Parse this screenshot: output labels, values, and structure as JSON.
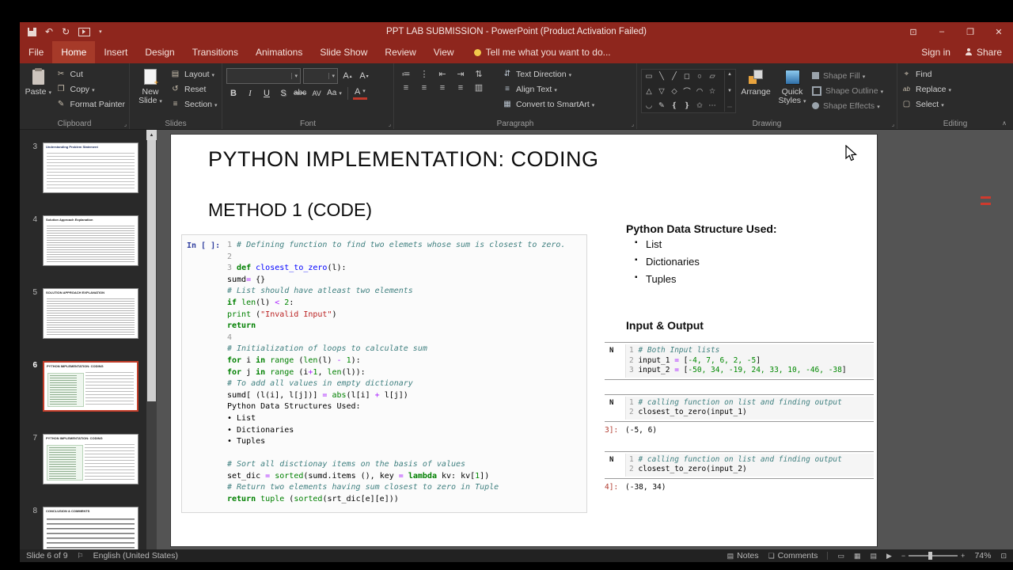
{
  "titlebar": {
    "title": "PPT LAB SUBMISSION - PowerPoint (Product Activation Failed)"
  },
  "menubar": {
    "tabs": [
      {
        "label": "File",
        "cls": "t-file"
      },
      {
        "label": "Home",
        "cls": "t-active"
      },
      {
        "label": "Insert",
        "cls": ""
      },
      {
        "label": "Design",
        "cls": ""
      },
      {
        "label": "Transitions",
        "cls": ""
      },
      {
        "label": "Animations",
        "cls": ""
      },
      {
        "label": "Slide Show",
        "cls": ""
      },
      {
        "label": "Review",
        "cls": ""
      },
      {
        "label": "View",
        "cls": ""
      }
    ],
    "tell_me": "Tell me what you want to do...",
    "sign_in": "Sign in",
    "share": "Share"
  },
  "ribbon": {
    "clipboard": {
      "label": "Clipboard",
      "paste": "Paste",
      "cut": "Cut",
      "copy": "Copy",
      "format_painter": "Format Painter"
    },
    "slides": {
      "label": "Slides",
      "new_slide": "New Slide",
      "layout": "Layout",
      "reset": "Reset",
      "section": "Section"
    },
    "font": {
      "label": "Font",
      "b": "B",
      "i": "I",
      "u": "U",
      "s": "S",
      "strike": "abc",
      "av": "AV",
      "aa": "Aa",
      "color": "A",
      "grow": "A",
      "shrink": "A"
    },
    "paragraph": {
      "label": "Paragraph",
      "text_direction": "Text Direction",
      "align_text": "Align Text",
      "smartart": "Convert to SmartArt"
    },
    "drawing": {
      "label": "Drawing",
      "arrange": "Arrange",
      "quick_styles": "Quick Styles",
      "shape_fill": "Shape Fill",
      "shape_outline": "Shape Outline",
      "shape_effects": "Shape Effects"
    },
    "editing": {
      "label": "Editing",
      "find": "Find",
      "replace": "Replace",
      "select": "Select"
    }
  },
  "icons": {
    "undo": "↶",
    "redo": "↻",
    "ribbon_display": "⊡",
    "minimize": "–",
    "restore": "❐",
    "close": "✕",
    "cut": "✂",
    "copy": "❐",
    "format_painter": "✎",
    "layout_ic": "▤",
    "reset_ic": "↺",
    "section_ic": "≡",
    "td": "⇵",
    "at": "≡",
    "sa": "▦",
    "para_row1": [
      "≔",
      "⋮",
      "⇤",
      "⇥",
      "⇅"
    ],
    "para_row2": [
      "≡",
      "≡",
      "≡",
      "≡",
      "▥"
    ],
    "shapes_r1": [
      "▭",
      "╲",
      "╱",
      "◻",
      "○",
      "▱"
    ],
    "shapes_r2": [
      "△",
      "▽",
      "◇",
      "⌒",
      "◠",
      "☆"
    ],
    "shapes_r3": [
      "◡",
      "✎",
      "❴",
      "❵",
      "✩",
      "⋯"
    ],
    "scroll_up": "▲",
    "scroll_dn": "▼",
    "more": "⋯",
    "find": "⌖",
    "replace_ab": "ab",
    "select": "▢",
    "flag": "⚐",
    "notes": "▤",
    "comments": "❏",
    "view_normal": "▭",
    "view_sorter": "▦",
    "view_reading": "▤",
    "view_show": "▶",
    "zoom_out": "−",
    "zoom_in": "+",
    "fit": "⊡",
    "collapse": "∧"
  },
  "sidebar": {
    "thumbnails": [
      {
        "num": "3",
        "cls": "kind-doc",
        "title": "Understanding Problem Statement"
      },
      {
        "num": "4",
        "cls": "kind-doc2",
        "title": "Solution Approach Explanation"
      },
      {
        "num": "5",
        "cls": "kind-doc2",
        "title": "SOLUTION APPROACH EXPLANATION"
      },
      {
        "num": "6",
        "cls": "kind-code sel",
        "title": "PYTHON IMPLEMENTATION: CODING"
      },
      {
        "num": "7",
        "cls": "kind-code",
        "title": "PYTHON IMPLEMENTATION: CODING"
      },
      {
        "num": "8",
        "cls": "kind-bullets",
        "title": "CONCLUSION & COMMENTS"
      }
    ]
  },
  "slide": {
    "title": "PYTHON IMPLEMENTATION: CODING",
    "subtitle": "METHOD 1 (CODE)",
    "in_prompt": "In [ ]:",
    "code_lines": [
      [
        [
          "ln",
          "1 "
        ],
        [
          "com",
          "# Defining function to find two elemets whose sum is closest to zero."
        ]
      ],
      [
        [
          "ln",
          "2"
        ]
      ],
      [
        [
          "ln",
          "3 "
        ],
        [
          "kw",
          "def"
        ],
        [
          "pl",
          " "
        ],
        [
          "fn",
          "closest_to_zero"
        ],
        [
          "pl",
          "(l):"
        ]
      ],
      [
        [
          "pl",
          "sumd"
        ],
        [
          "op",
          "="
        ],
        [
          "pl",
          " {}"
        ]
      ],
      [
        [
          "com",
          "# List should have atleast two elements"
        ]
      ],
      [
        [
          "kw",
          "if"
        ],
        [
          "pl",
          " "
        ],
        [
          "bi",
          "len"
        ],
        [
          "pl",
          "(l) "
        ],
        [
          "op",
          "<"
        ],
        [
          "pl",
          " "
        ],
        [
          "nm",
          "2"
        ],
        [
          "pl",
          ":"
        ]
      ],
      [
        [
          "bi",
          "print"
        ],
        [
          "pl",
          " ("
        ],
        [
          "st",
          "\"Invalid Input\""
        ],
        [
          "pl",
          ")"
        ]
      ],
      [
        [
          "kw",
          "return"
        ]
      ],
      [
        [
          "ln",
          "4"
        ]
      ],
      [
        [
          "com",
          "# Initialization of loops to calculate sum"
        ]
      ],
      [
        [
          "kw",
          "for"
        ],
        [
          "pl",
          " i "
        ],
        [
          "kw",
          "in"
        ],
        [
          "pl",
          " "
        ],
        [
          "bi",
          "range"
        ],
        [
          "pl",
          " ("
        ],
        [
          "bi",
          "len"
        ],
        [
          "pl",
          "(l) "
        ],
        [
          "op",
          "-"
        ],
        [
          "pl",
          " "
        ],
        [
          "nm",
          "1"
        ],
        [
          "pl",
          "):"
        ]
      ],
      [
        [
          "kw",
          "for"
        ],
        [
          "pl",
          " j "
        ],
        [
          "kw",
          "in"
        ],
        [
          "pl",
          " "
        ],
        [
          "bi",
          "range"
        ],
        [
          "pl",
          " (i"
        ],
        [
          "op",
          "+"
        ],
        [
          "nm",
          "1"
        ],
        [
          "pl",
          ", "
        ],
        [
          "bi",
          "len"
        ],
        [
          "pl",
          "(l)):"
        ]
      ],
      [
        [
          "com",
          "# To add all values in empty dictionary"
        ]
      ],
      [
        [
          "pl",
          "sumd[ (l(i], l[j])] "
        ],
        [
          "op",
          "="
        ],
        [
          "pl",
          " "
        ],
        [
          "bi",
          "abs"
        ],
        [
          "pl",
          "(l[i] "
        ],
        [
          "op",
          "+"
        ],
        [
          "pl",
          " l[j])"
        ]
      ],
      [
        [
          "pl",
          "Python Data Structures Used:"
        ]
      ],
      [
        [
          "pl",
          "• List"
        ]
      ],
      [
        [
          "pl",
          "• Dictionaries"
        ]
      ],
      [
        [
          "pl",
          "• Tuples"
        ]
      ],
      [],
      [
        [
          "com",
          "# Sort all disctionay items on the basis of values"
        ]
      ],
      [
        [
          "pl",
          "set_dic "
        ],
        [
          "op",
          "="
        ],
        [
          "pl",
          " "
        ],
        [
          "bi",
          "sorted"
        ],
        [
          "pl",
          "(sumd.items (), key "
        ],
        [
          "op",
          "="
        ],
        [
          "pl",
          " "
        ],
        [
          "kw",
          "lambda"
        ],
        [
          "pl",
          " kv: kv["
        ],
        [
          "nm",
          "1"
        ],
        [
          "pl",
          "])"
        ]
      ],
      [
        [
          "com",
          "# Return two elements having sum closest to zero in Tuple"
        ]
      ],
      [
        [
          "kw",
          "return"
        ],
        [
          "pl",
          " "
        ],
        [
          "bi",
          "tuple"
        ],
        [
          "pl",
          " ("
        ],
        [
          "bi",
          "sorted"
        ],
        [
          "pl",
          "(srt_dic[e][e]))"
        ]
      ]
    ],
    "right": {
      "ds_heading": "Python Data Structure Used:",
      "ds_items": [
        "List",
        "Dictionaries",
        "Tuples"
      ],
      "io_heading": "Input & Output",
      "cells": [
        {
          "prompt": "N",
          "lines": [
            [
              [
                "ln",
                "1 "
              ],
              [
                "com",
                "# Both Input lists"
              ]
            ],
            [
              [
                "ln",
                "2 "
              ],
              [
                "pl",
                "input_1 "
              ],
              [
                "op",
                "="
              ],
              [
                "pl",
                " ["
              ],
              [
                "nm",
                "-4, 7, 6, 2, -5"
              ],
              [
                "pl",
                "]"
              ]
            ],
            [
              [
                "ln",
                "3 "
              ],
              [
                "pl",
                "input_2 "
              ],
              [
                "op",
                "="
              ],
              [
                "pl",
                " ["
              ],
              [
                "nm",
                "-50, 34, -19, 24, 33, 10, -46, -38"
              ],
              [
                "pl",
                "]"
              ]
            ]
          ],
          "out_prompt": "",
          "out_value": ""
        },
        {
          "prompt": "N",
          "lines": [
            [
              [
                "ln",
                "1 "
              ],
              [
                "com",
                "# calling function on list and finding output"
              ]
            ],
            [
              [
                "ln",
                "2 "
              ],
              [
                "pl",
                "closest_to_zero(input_1)"
              ]
            ]
          ],
          "out_prompt": "3]:",
          "out_value": "(-5, 6)"
        },
        {
          "prompt": "N",
          "lines": [
            [
              [
                "ln",
                "1 "
              ],
              [
                "com",
                "# calling function on list and finding output"
              ]
            ],
            [
              [
                "ln",
                "2 "
              ],
              [
                "pl",
                "closest_to_zero(input_2)"
              ]
            ]
          ],
          "out_prompt": "4]:",
          "out_value": "(-38, 34)"
        }
      ]
    }
  },
  "statusbar": {
    "slide_info": "Slide 6 of 9",
    "language": "English (United States)",
    "notes": "Notes",
    "comments": "Comments",
    "zoom_percent": "74%"
  }
}
